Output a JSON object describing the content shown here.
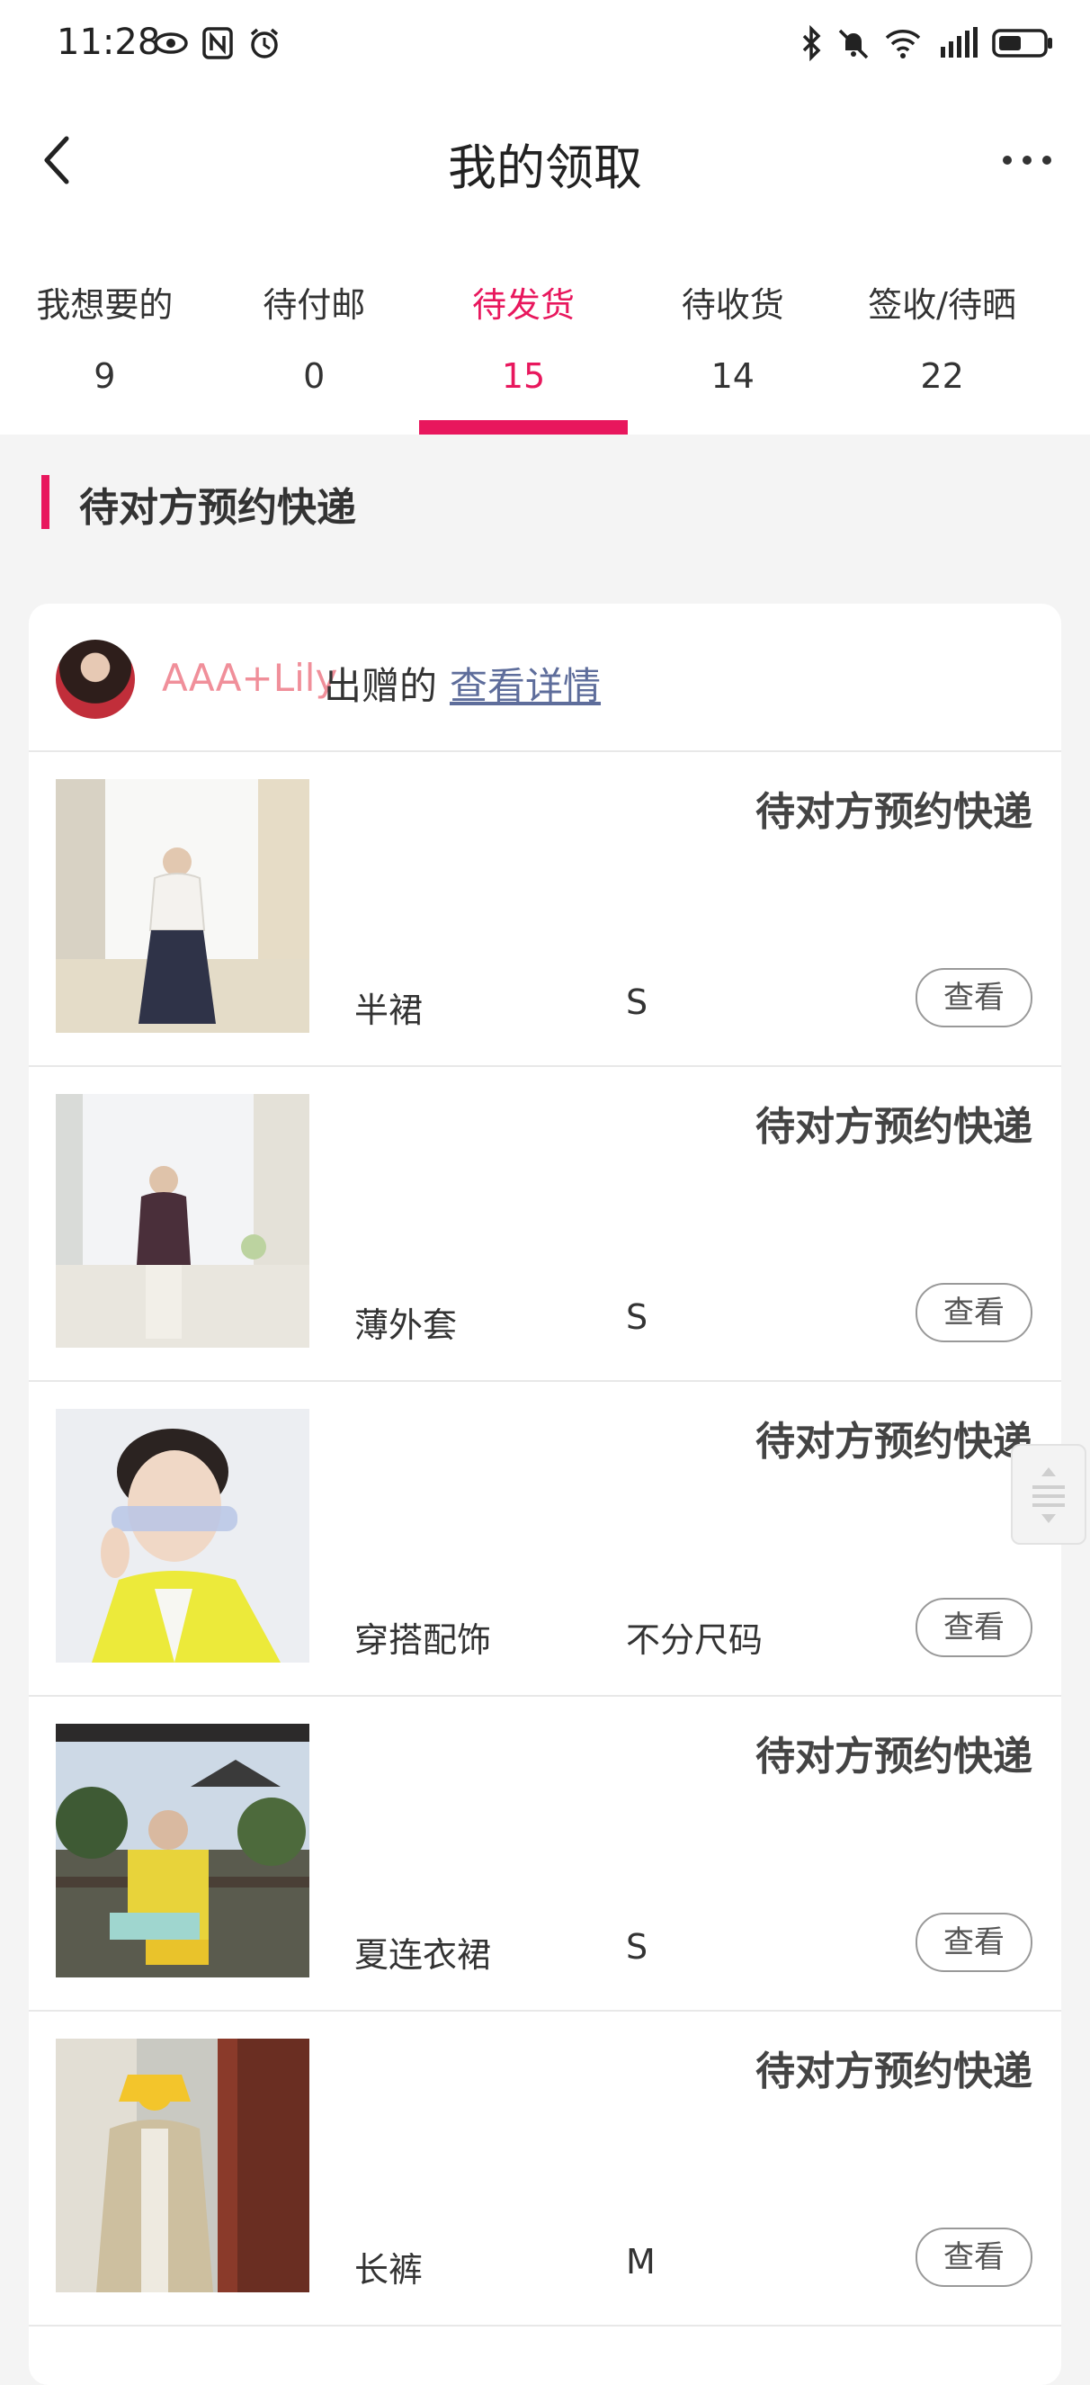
{
  "status_bar": {
    "time": "11:28"
  },
  "header": {
    "title": "我的领取"
  },
  "tabs": [
    {
      "label": "我想要的",
      "count": "9"
    },
    {
      "label": "待付邮",
      "count": "0"
    },
    {
      "label": "待发货",
      "count": "15"
    },
    {
      "label": "待收货",
      "count": "14"
    },
    {
      "label": "签收/待晒",
      "count": "22"
    }
  ],
  "active_tab_index": 2,
  "section": {
    "title": "待对方预约快递"
  },
  "giver": {
    "name": "AAA+Lily",
    "verb": "出赠的",
    "link": "查看详情"
  },
  "items": [
    {
      "status": "待对方预约快递",
      "name": "半裙",
      "size": "S",
      "button": "查看"
    },
    {
      "status": "待对方预约快递",
      "name": "薄外套",
      "size": "S",
      "button": "查看"
    },
    {
      "status": "待对方预约快递",
      "name": "穿搭配饰",
      "size": "不分尺码",
      "button": "查看"
    },
    {
      "status": "待对方预约快递",
      "name": "夏连衣裙",
      "size": "S",
      "button": "查看"
    },
    {
      "status": "待对方预约快递",
      "name": "长裤",
      "size": "M",
      "button": "查看"
    }
  ],
  "colors": {
    "accent": "#e8175d",
    "giver_name": "#f08f9a",
    "link": "#5e6d9b",
    "background": "#f4f4f4"
  }
}
